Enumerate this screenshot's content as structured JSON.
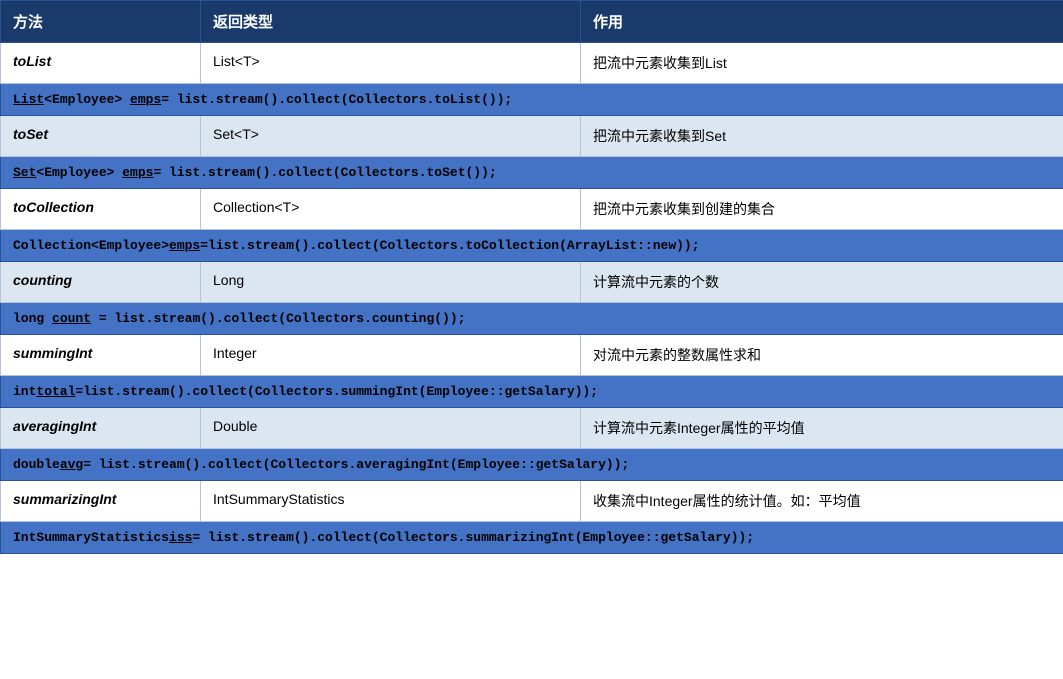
{
  "table": {
    "headers": [
      "方法",
      "返回类型",
      "作用"
    ],
    "rows": [
      {
        "type": "method",
        "cells": [
          "toList",
          "List<T>",
          "把流中元素收集到List"
        ],
        "code": null
      },
      {
        "type": "code",
        "code": "List<Employee> emps= list.stream().collect(Collectors.toList());",
        "underline_parts": [
          "List",
          "emps"
        ]
      },
      {
        "type": "method-alt",
        "cells": [
          "toSet",
          "Set<T>",
          "把流中元素收集到Set"
        ],
        "code": null
      },
      {
        "type": "code",
        "code": "Set<Employee> emps= list.stream().collect(Collectors.toSet());",
        "underline_parts": [
          "Set",
          "emps"
        ]
      },
      {
        "type": "method",
        "cells": [
          "toCollection",
          "Collection<T>",
          "把流中元素收集到创建的集合"
        ],
        "code": null
      },
      {
        "type": "code",
        "code": "Collection<Employee>emps=list.stream().collect(Collectors.toCollection(ArrayList::new));",
        "underline_parts": [
          "emps"
        ]
      },
      {
        "type": "method-alt",
        "cells": [
          "counting",
          "Long",
          "计算流中元素的个数"
        ],
        "code": null
      },
      {
        "type": "code",
        "code": "long count = list.stream().collect(Collectors.counting());",
        "underline_parts": [
          "count"
        ]
      },
      {
        "type": "method",
        "cells": [
          "summingInt",
          "Integer",
          "对流中元素的整数属性求和"
        ],
        "code": null
      },
      {
        "type": "code",
        "code": "inttotal=list.stream().collect(Collectors.summingInt(Employee::getSalary));",
        "underline_parts": [
          "total"
        ]
      },
      {
        "type": "method-alt",
        "cells": [
          "averagingInt",
          "Double",
          "计算流中元素Integer属性的平均值"
        ],
        "code": null
      },
      {
        "type": "code",
        "code": "doubleavg= list.stream().collect(Collectors.averagingInt(Employee::getSalary));",
        "underline_parts": [
          "avg"
        ]
      },
      {
        "type": "method",
        "cells": [
          "summarizingInt",
          "IntSummaryStatistics",
          "收集流中Integer属性的统计值。如：平均值"
        ],
        "code": null
      },
      {
        "type": "code",
        "code": "IntSummaryStatisticsiss= list.stream().collect(Collectors.summarizingInt(Employee::getSalary));",
        "underline_parts": [
          "iss"
        ]
      }
    ]
  }
}
